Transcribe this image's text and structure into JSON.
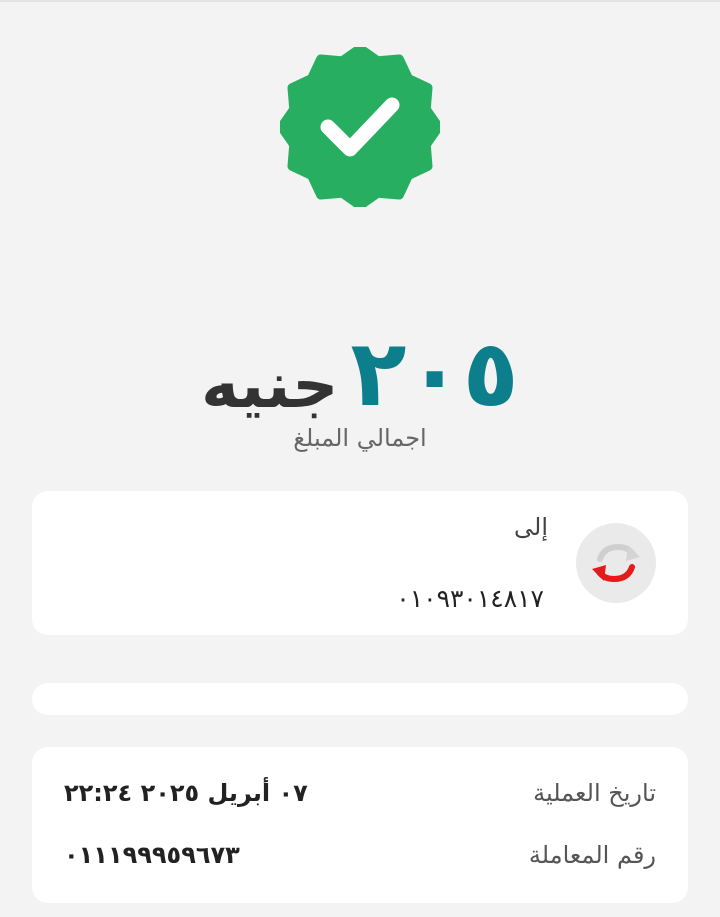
{
  "status": {
    "icon": "success-check-badge-icon",
    "color": "#27ae60"
  },
  "amount": {
    "value": "٢٠٥",
    "currency": "جنيه",
    "caption": "اجمالي المبلغ",
    "value_color": "#0d7f8c"
  },
  "recipient": {
    "label": "إلى",
    "number": "٠١٠٩٣٠١٤٨١٧",
    "icon": "transfer-arrows-icon"
  },
  "details": {
    "date_label": "تاريخ العملية",
    "date_value": "٠٧ أبريل ٢٠٢٥  ٢٢:٢٤",
    "txn_label": "رقم المعاملة",
    "txn_value": "٠١١١٩٩٩٥٩٦٧٣"
  }
}
